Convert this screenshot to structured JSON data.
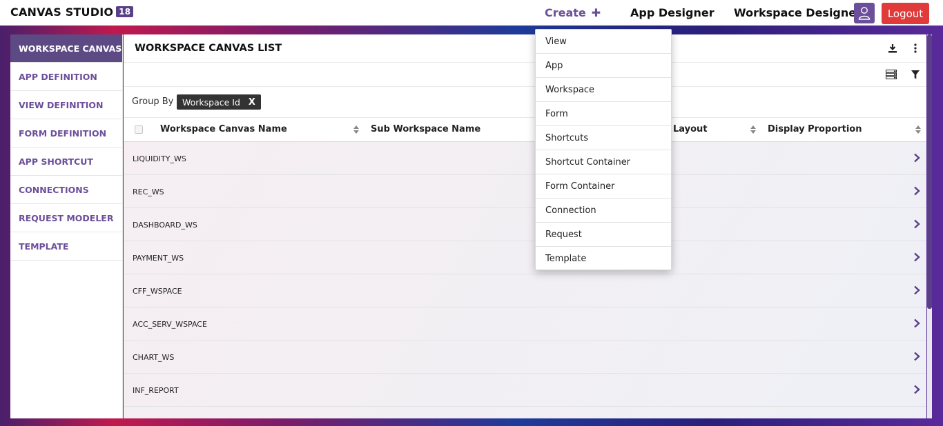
{
  "brand": {
    "name": "CANVAS STUDIO",
    "version": "18"
  },
  "nav": {
    "create_label": "Create",
    "create_icon": "plus-icon",
    "app_designer": "App Designer",
    "workspace_designer": "Workspace Designer",
    "user_icon": "user-icon",
    "logout": "Logout"
  },
  "sidebar": {
    "items": [
      {
        "label": "WORKSPACE CANVAS",
        "active": true
      },
      {
        "label": "APP DEFINITION"
      },
      {
        "label": "VIEW DEFINITION"
      },
      {
        "label": "FORM DEFINITION"
      },
      {
        "label": "APP SHORTCUT"
      },
      {
        "label": "CONNECTIONS"
      },
      {
        "label": "REQUEST MODELER"
      },
      {
        "label": "TEMPLATE"
      }
    ]
  },
  "main": {
    "title": "WORKSPACE CANVAS LIST",
    "group_by_label": "Group By",
    "group_chip": "Workspace Id",
    "group_chip_close": "X",
    "columns": [
      "Workspace Canvas Name",
      "Sub Workspace Name",
      "Layout",
      "Display Proportion"
    ],
    "rows": [
      "LIQUIDITY_WS",
      "REC_WS",
      "DASHBOARD_WS",
      "PAYMENT_WS",
      "CFF_WSPACE",
      "ACC_SERV_WSPACE",
      "CHART_WS",
      "INF_REPORT"
    ]
  },
  "create_menu": {
    "items": [
      "View",
      "App",
      "Workspace",
      "Form",
      "Shortcuts",
      "Shortcut Container",
      "Form Container",
      "Connection",
      "Request",
      "Template"
    ]
  },
  "colors": {
    "accent": "#6b4f9a",
    "active_sidebar": "#5d4a84",
    "logout": "#e03a3a"
  }
}
